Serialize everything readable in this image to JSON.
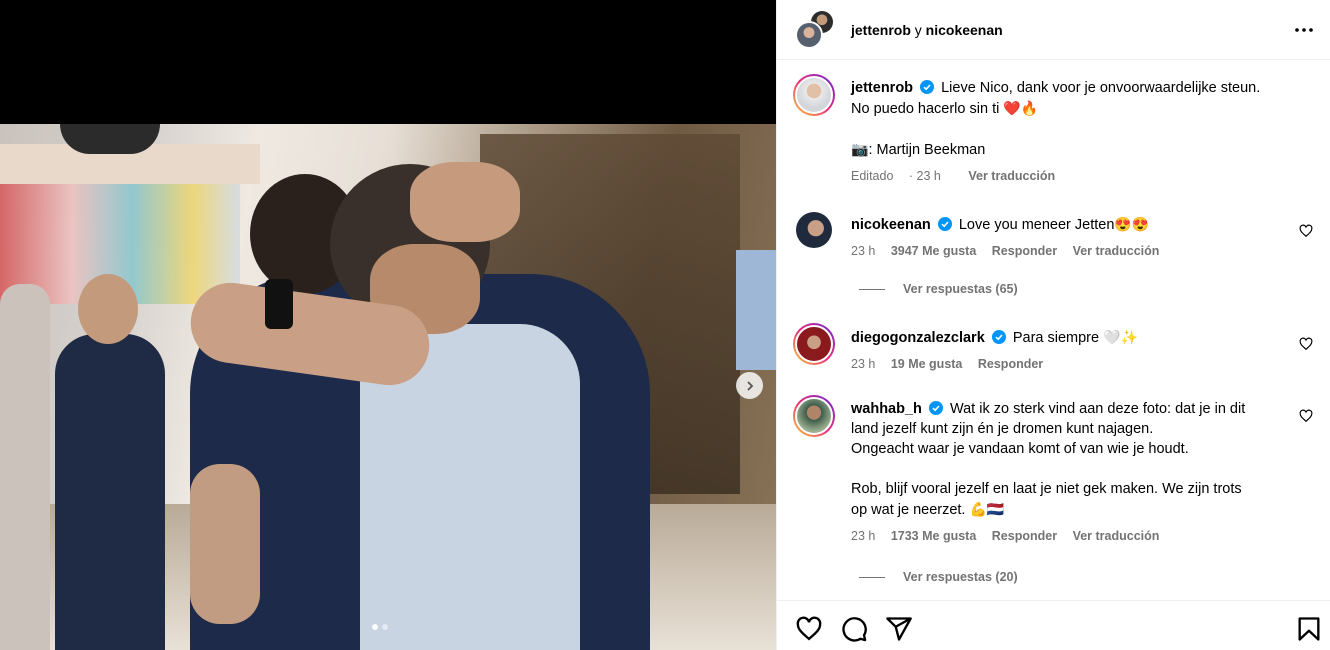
{
  "post": {
    "header": {
      "user1": "jettenrob",
      "separator": "y",
      "user2": "nicokeenan",
      "more_icon": "more-horizontal-icon"
    },
    "caption": {
      "username": "jettenrob",
      "text_line1": "Lieve Nico, dank voor je onvoorwaardelijke steun.",
      "text_line2": "No puedo hacerlo sin ti",
      "text_line2_emoji": "❤️🔥",
      "credit_emoji": "📷",
      "credit": ": Martijn Beekman",
      "edited": "Editado",
      "time": "23 h",
      "translate": "Ver traducción"
    },
    "comments": [
      {
        "username": "nicokeenan",
        "text": "Love you meneer Jetten",
        "emoji": "😍😍",
        "time": "23 h",
        "likes": "3947 Me gusta",
        "reply": "Responder",
        "translate": "Ver traducción",
        "replies": "Ver respuestas (65)"
      },
      {
        "username": "diegogonzalezclark",
        "text": "Para siempre",
        "emoji": "🤍✨",
        "time": "23 h",
        "likes": "19 Me gusta",
        "reply": "Responder"
      },
      {
        "username": "wahhab_h",
        "text_line1": "Wat ik zo sterk vind aan deze foto: dat je in dit",
        "text_line2": "land jezelf kunt zijn én je dromen kunt najagen.",
        "text_line3": "Ongeacht waar je vandaan komt of van wie je houdt.",
        "text_line4": "Rob, blijf vooral jezelf en laat je niet gek maken. We zijn trots",
        "text_line5": "op wat je neerzet.",
        "emoji": "💪🇳🇱",
        "time": "23 h",
        "likes": "1733 Me gusta",
        "reply": "Responder",
        "translate": "Ver traducción",
        "replies": "Ver respuestas (20)"
      }
    ],
    "actions": {
      "like_icon": "heart-icon",
      "comment_icon": "comment-icon",
      "share_icon": "share-icon",
      "save_icon": "bookmark-icon"
    },
    "colors": {
      "verified": "#0095f6",
      "secondary_text": "#737373",
      "border": "#efefef"
    }
  }
}
